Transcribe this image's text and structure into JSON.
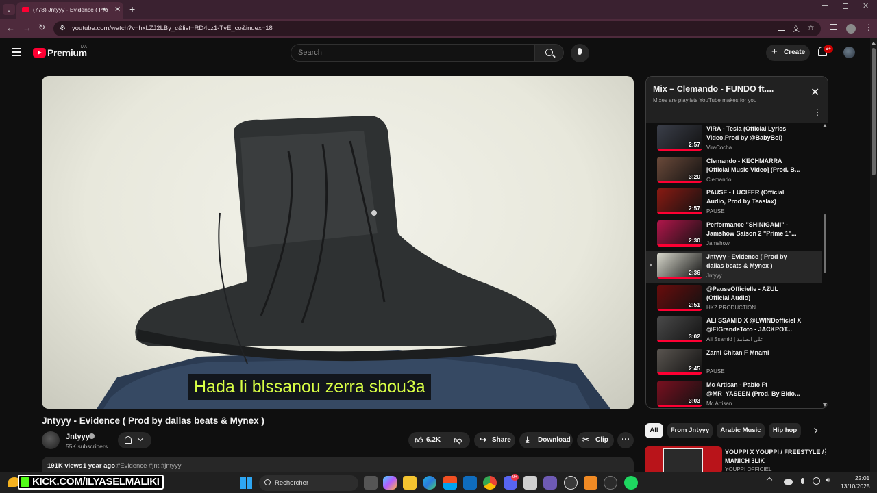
{
  "browser": {
    "tab_title": "(778) Jntyyy - Evidence ( Pro",
    "url": "youtube.com/watch?v=hxLZJ2LBy_c&list=RD4cz1-TvE_co&index=18"
  },
  "header": {
    "logo_text": "Premium",
    "logo_badge": "MA",
    "search_placeholder": "Search",
    "create_label": "Create",
    "notif_badge": "9+"
  },
  "video": {
    "subtitle": "Hada li blssanou zerra sbou3a",
    "title": "Jntyyy - Evidence ( Prod by dallas beats & Mynex )",
    "channel": "Jntyyy",
    "subscribers": "55K subscribers",
    "likes": "6.2K",
    "share_label": "Share",
    "download_label": "Download",
    "clip_label": "Clip",
    "views": "191K views",
    "age": "1 year ago",
    "tags": "#Evidence #jnt #jntyyy"
  },
  "playlist": {
    "title": "Mix – Clemando - FUNDO ft....",
    "subtitle": "Mixes are playlists YouTube makes for you",
    "items": [
      {
        "title": "VIRA - Tesla (Official Lyrics Video,Prod by @BabyBoi)",
        "channel": "ViraCocha",
        "duration": "2:57",
        "color": "#3b3f4a"
      },
      {
        "title": "Clemando - KECHMARRA [Official Music Video] (Prod. B...",
        "channel": "Clemando",
        "duration": "3:20",
        "color": "#6b4a3a"
      },
      {
        "title": "PAUSE - LUCIFER (Official Audio, Prod by Teaslax)",
        "channel": "PAUSE",
        "duration": "2:57",
        "color": "#8a1a12"
      },
      {
        "title": "Performance \"SHINIGAMI\" - Jamshow Saison 2 \"Prime 1\"...",
        "channel": "Jamshow",
        "duration": "2:30",
        "color": "#b0164a"
      },
      {
        "title": "Jntyyy - Evidence ( Prod by dallas beats & Mynex )",
        "channel": "Jntyyy",
        "duration": "2:36",
        "color": "#d8d8cc"
      },
      {
        "title": "@PauseOfficielle - AZUL (Official Audio)",
        "channel": "HKZ PRODUCTION",
        "duration": "2:51",
        "color": "#6a0c0c"
      },
      {
        "title": "ALI SSAMID X @LWINDofficiel X @ElGrandeToto - JACKPOT...",
        "channel": "Ali Ssamid | علي الصامد",
        "duration": "3:02",
        "color": "#4a4a4a"
      },
      {
        "title": "Zarni Chitan F Mnami",
        "channel": "PAUSE",
        "duration": "2:45",
        "color": "#5a5550"
      },
      {
        "title": "Mc Artisan - Pablo Ft @MR_YASEEN (Prod. By Bido...",
        "channel": "Mc Artisan",
        "duration": "3:03",
        "color": "#7a1020"
      }
    ]
  },
  "chips": [
    "All",
    "From Jntyyy",
    "Arabic Music",
    "Hip hop"
  ],
  "recommended": {
    "title": "YOUPPI X YOUPPI / FREESTYLE / MANICH 3LIK",
    "channel": "YOUPPI OFFICIEL"
  },
  "taskbar": {
    "overlay_text": "KICK.COM/ILYASELMALIKI",
    "search_label": "Rechercher",
    "discord_badge": "9+",
    "time": "22:01",
    "date": "13/10/2025"
  }
}
